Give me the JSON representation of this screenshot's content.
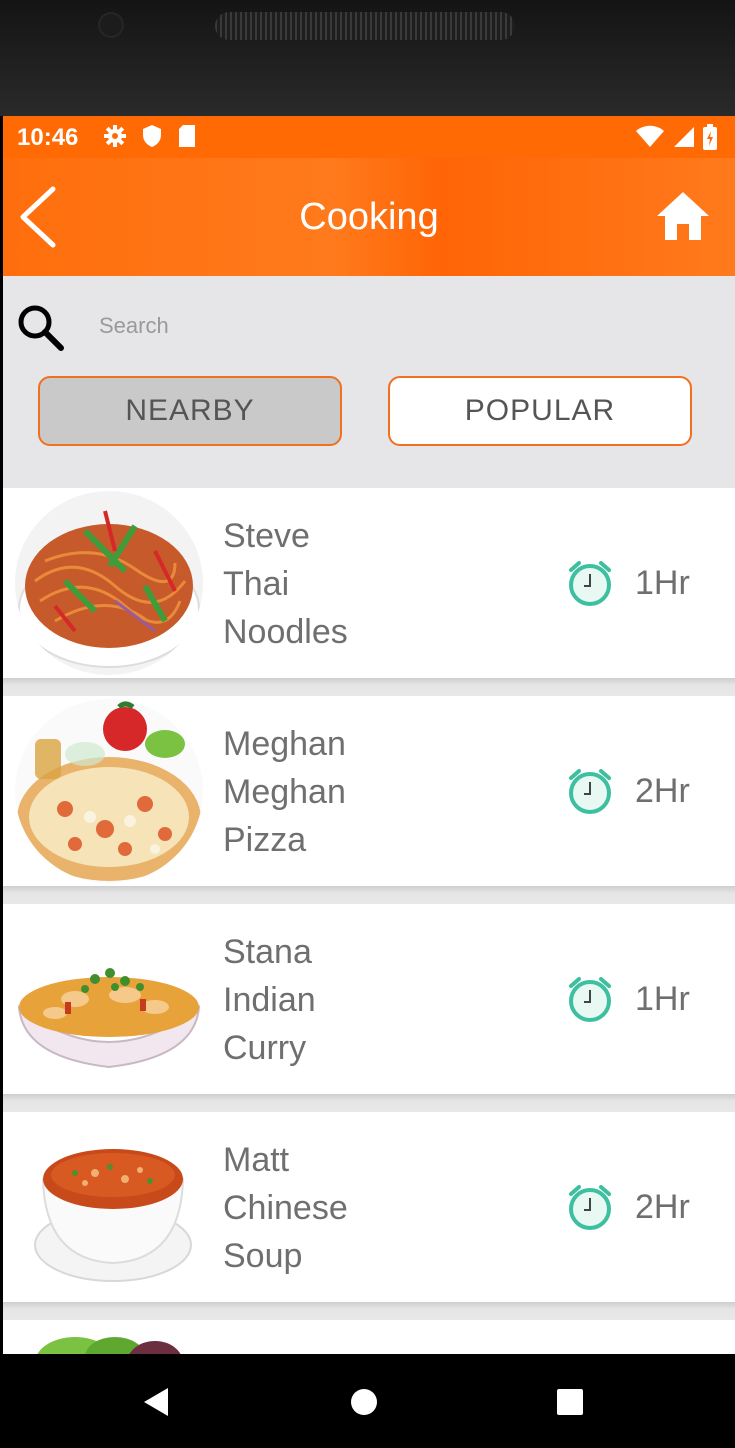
{
  "status_bar": {
    "time": "10:46",
    "icons_left": [
      "gear-icon",
      "shield-icon",
      "sd-card-icon"
    ],
    "icons_right": [
      "wifi-icon",
      "signal-icon",
      "battery-icon"
    ]
  },
  "app_bar": {
    "title": "Cooking",
    "back_icon": "chevron-left-icon",
    "home_icon": "home-icon"
  },
  "search": {
    "placeholder": "Search",
    "value": ""
  },
  "filters": {
    "nearby": "NEARBY",
    "popular": "POPULAR",
    "selected": "NEARBY"
  },
  "colors": {
    "accent": "#ff6a05",
    "clock": "#3dbfa0",
    "text": "#6f6f6f"
  },
  "items": [
    {
      "name": "Steve",
      "line2": "Thai",
      "line3": "Noodles",
      "duration": "1Hr"
    },
    {
      "name": "Meghan",
      "line2": "Meghan",
      "line3": "Pizza",
      "duration": "2Hr"
    },
    {
      "name": "Stana",
      "line2": "Indian",
      "line3": "Curry",
      "duration": "1Hr"
    },
    {
      "name": "Matt",
      "line2": "Chinese",
      "line3": "Soup",
      "duration": "2Hr"
    }
  ],
  "nav": [
    "back-triangle-icon",
    "home-circle-icon",
    "recents-square-icon"
  ]
}
